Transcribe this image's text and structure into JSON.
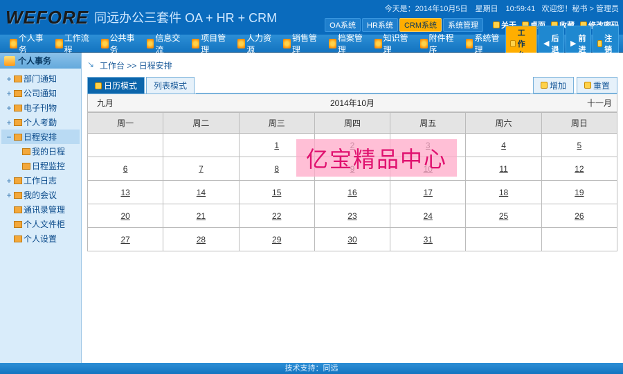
{
  "banner": {
    "logo": "WEFORE",
    "title": "同远办公三套件 OA + HR + CRM",
    "today_prefix": "今天是：",
    "today": "2014年10月5日　星期日　10:59:41",
    "welcome": "欢迎您！秘书 > 管理员",
    "sys_tabs": [
      "OA系统",
      "HR系统",
      "CRM系统",
      "系统管理"
    ],
    "sys_active": 2,
    "top_links": [
      "关于",
      "桌面",
      "收藏",
      "修改密码"
    ]
  },
  "mainnav": {
    "items": [
      "个人事务",
      "工作流程",
      "公共事务",
      "信息交流",
      "项目管理",
      "人力资源",
      "销售管理",
      "档案管理",
      "知识管理",
      "附件程序",
      "系统管理"
    ],
    "right": {
      "workbench": "工作台",
      "back": "后退",
      "forward": "前进",
      "register": "注销"
    }
  },
  "sidebar": {
    "title": "个人事务",
    "tree": [
      {
        "label": "部门通知",
        "depth": 1,
        "expand": "+"
      },
      {
        "label": "公司通知",
        "depth": 1,
        "expand": "+"
      },
      {
        "label": "电子刊物",
        "depth": 1,
        "expand": "+"
      },
      {
        "label": "个人考勤",
        "depth": 1,
        "expand": "+"
      },
      {
        "label": "日程安排",
        "depth": 1,
        "expand": "−",
        "sel": true
      },
      {
        "label": "我的日程",
        "depth": 2,
        "expand": ""
      },
      {
        "label": "日程监控",
        "depth": 2,
        "expand": ""
      },
      {
        "label": "工作日志",
        "depth": 1,
        "expand": "+"
      },
      {
        "label": "我的会议",
        "depth": 1,
        "expand": "+"
      },
      {
        "label": "通讯录管理",
        "depth": 1,
        "expand": ""
      },
      {
        "label": "个人文件柜",
        "depth": 1,
        "expand": ""
      },
      {
        "label": "个人设置",
        "depth": 1,
        "expand": ""
      }
    ]
  },
  "crumb": {
    "a": "工作台",
    "sep": " >> ",
    "b": "日程安排"
  },
  "viewtabs": {
    "cal": "日历模式",
    "list": "列表模式",
    "add": "增加",
    "reset": "重置"
  },
  "calendar": {
    "prev": "九月",
    "title": "2014年10月",
    "next": "十一月",
    "weekdays": [
      "周一",
      "周二",
      "周三",
      "周四",
      "周五",
      "周六",
      "周日"
    ],
    "cells": [
      [
        "",
        "",
        "1",
        "2",
        "3",
        "4",
        "5"
      ],
      [
        "6",
        "7",
        "8",
        "9",
        "10",
        "11",
        "12"
      ],
      [
        "13",
        "14",
        "15",
        "16",
        "17",
        "18",
        "19"
      ],
      [
        "20",
        "21",
        "22",
        "23",
        "24",
        "25",
        "26"
      ],
      [
        "27",
        "28",
        "29",
        "30",
        "31",
        "",
        ""
      ]
    ]
  },
  "watermark": "亿宝精品中心",
  "footer": "技术支持：同远"
}
